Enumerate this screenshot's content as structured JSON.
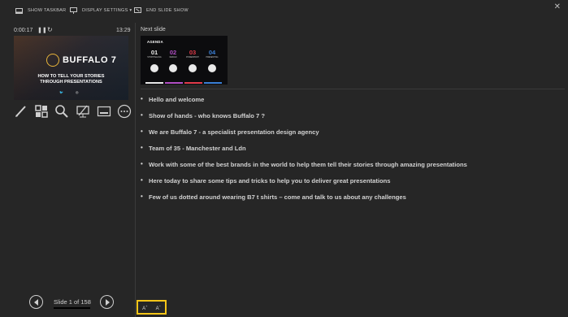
{
  "toolbar": {
    "show_taskbar": "SHOW TASKBAR",
    "display_settings": "DISPLAY SETTINGS ▾",
    "end_slide_show": "END SLIDE SHOW"
  },
  "timer": {
    "elapsed": "0:00:17",
    "clock": "13:29"
  },
  "current_slide": {
    "logo_text": "BUFFALO 7",
    "subtitle_line1": "HOW TO TELL YOUR STORIES",
    "subtitle_line2": "THROUGH PRESENTATIONS"
  },
  "tools": [
    "pen-icon",
    "see-all-slides-icon",
    "zoom-icon",
    "black-screen-icon",
    "subtitles-icon",
    "more-options-icon"
  ],
  "navigation": {
    "slide_counter": "Slide 1 of 158"
  },
  "next_slide": {
    "label": "Next slide",
    "agenda_title": "AGENDA",
    "items": [
      {
        "num": "01",
        "text": "STORYTELLING",
        "color": "#e8e8e8"
      },
      {
        "num": "02",
        "text": "DESIGN",
        "color": "#b24fc4"
      },
      {
        "num": "03",
        "text": "POWERPOINT",
        "color": "#e23b4a"
      },
      {
        "num": "04",
        "text": "PRESENTING",
        "color": "#3a7fd5"
      }
    ]
  },
  "notes": [
    "Hello and welcome",
    "Show of hands - who knows Buffalo 7 ?",
    "We are Buffalo 7 - a specialist presentation design agency",
    "Team of 35 - Manchester and Ldn",
    "Work with some of the best brands in the world to help them tell their stories through amazing presentations",
    "Here today to share some tips and tricks to help you to deliver great presentations",
    "Few of us dotted around wearing B7 t shirts – come and talk to us about any challenges"
  ],
  "font_controls": {
    "increase": "A",
    "decrease": "A"
  },
  "colors": {
    "highlight": "#f5c518",
    "background": "#262626",
    "logo_accent": "#e8b43a"
  }
}
